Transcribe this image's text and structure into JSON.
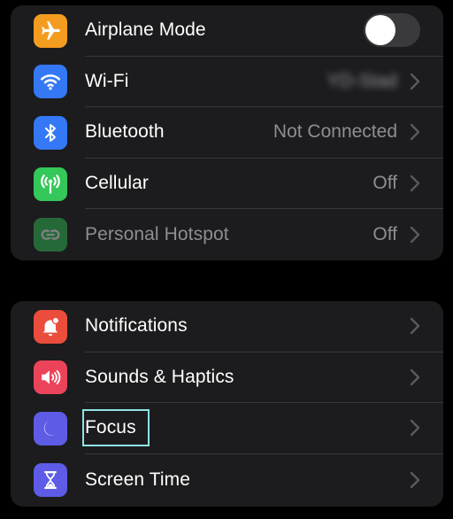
{
  "colors": {
    "airplane": "#f39c1f",
    "wifi": "#3478f6",
    "bluetooth": "#3478f6",
    "cellular": "#34c759",
    "hotspot": "#34c759",
    "notifications": "#eb4d3d",
    "sounds": "#eb445a",
    "focus": "#5e5ce6",
    "screen_time": "#5e5ce6"
  },
  "connectivity": {
    "airplane": {
      "label": "Airplane Mode",
      "icon": "airplane-icon",
      "toggle_on": false
    },
    "wifi": {
      "label": "Wi-Fi",
      "value": "YD-Stad",
      "icon": "wifi-icon"
    },
    "bluetooth": {
      "label": "Bluetooth",
      "value": "Not Connected",
      "icon": "bluetooth-icon"
    },
    "cellular": {
      "label": "Cellular",
      "value": "Off",
      "icon": "cellular-antenna-icon"
    },
    "hotspot": {
      "label": "Personal Hotspot",
      "value": "Off",
      "icon": "hotspot-link-icon"
    }
  },
  "general": {
    "notifications": {
      "label": "Notifications",
      "icon": "bell-icon"
    },
    "sounds": {
      "label": "Sounds & Haptics",
      "icon": "speaker-icon"
    },
    "focus": {
      "label": "Focus",
      "icon": "moon-icon"
    },
    "screen_time": {
      "label": "Screen Time",
      "icon": "hourglass-icon"
    }
  }
}
